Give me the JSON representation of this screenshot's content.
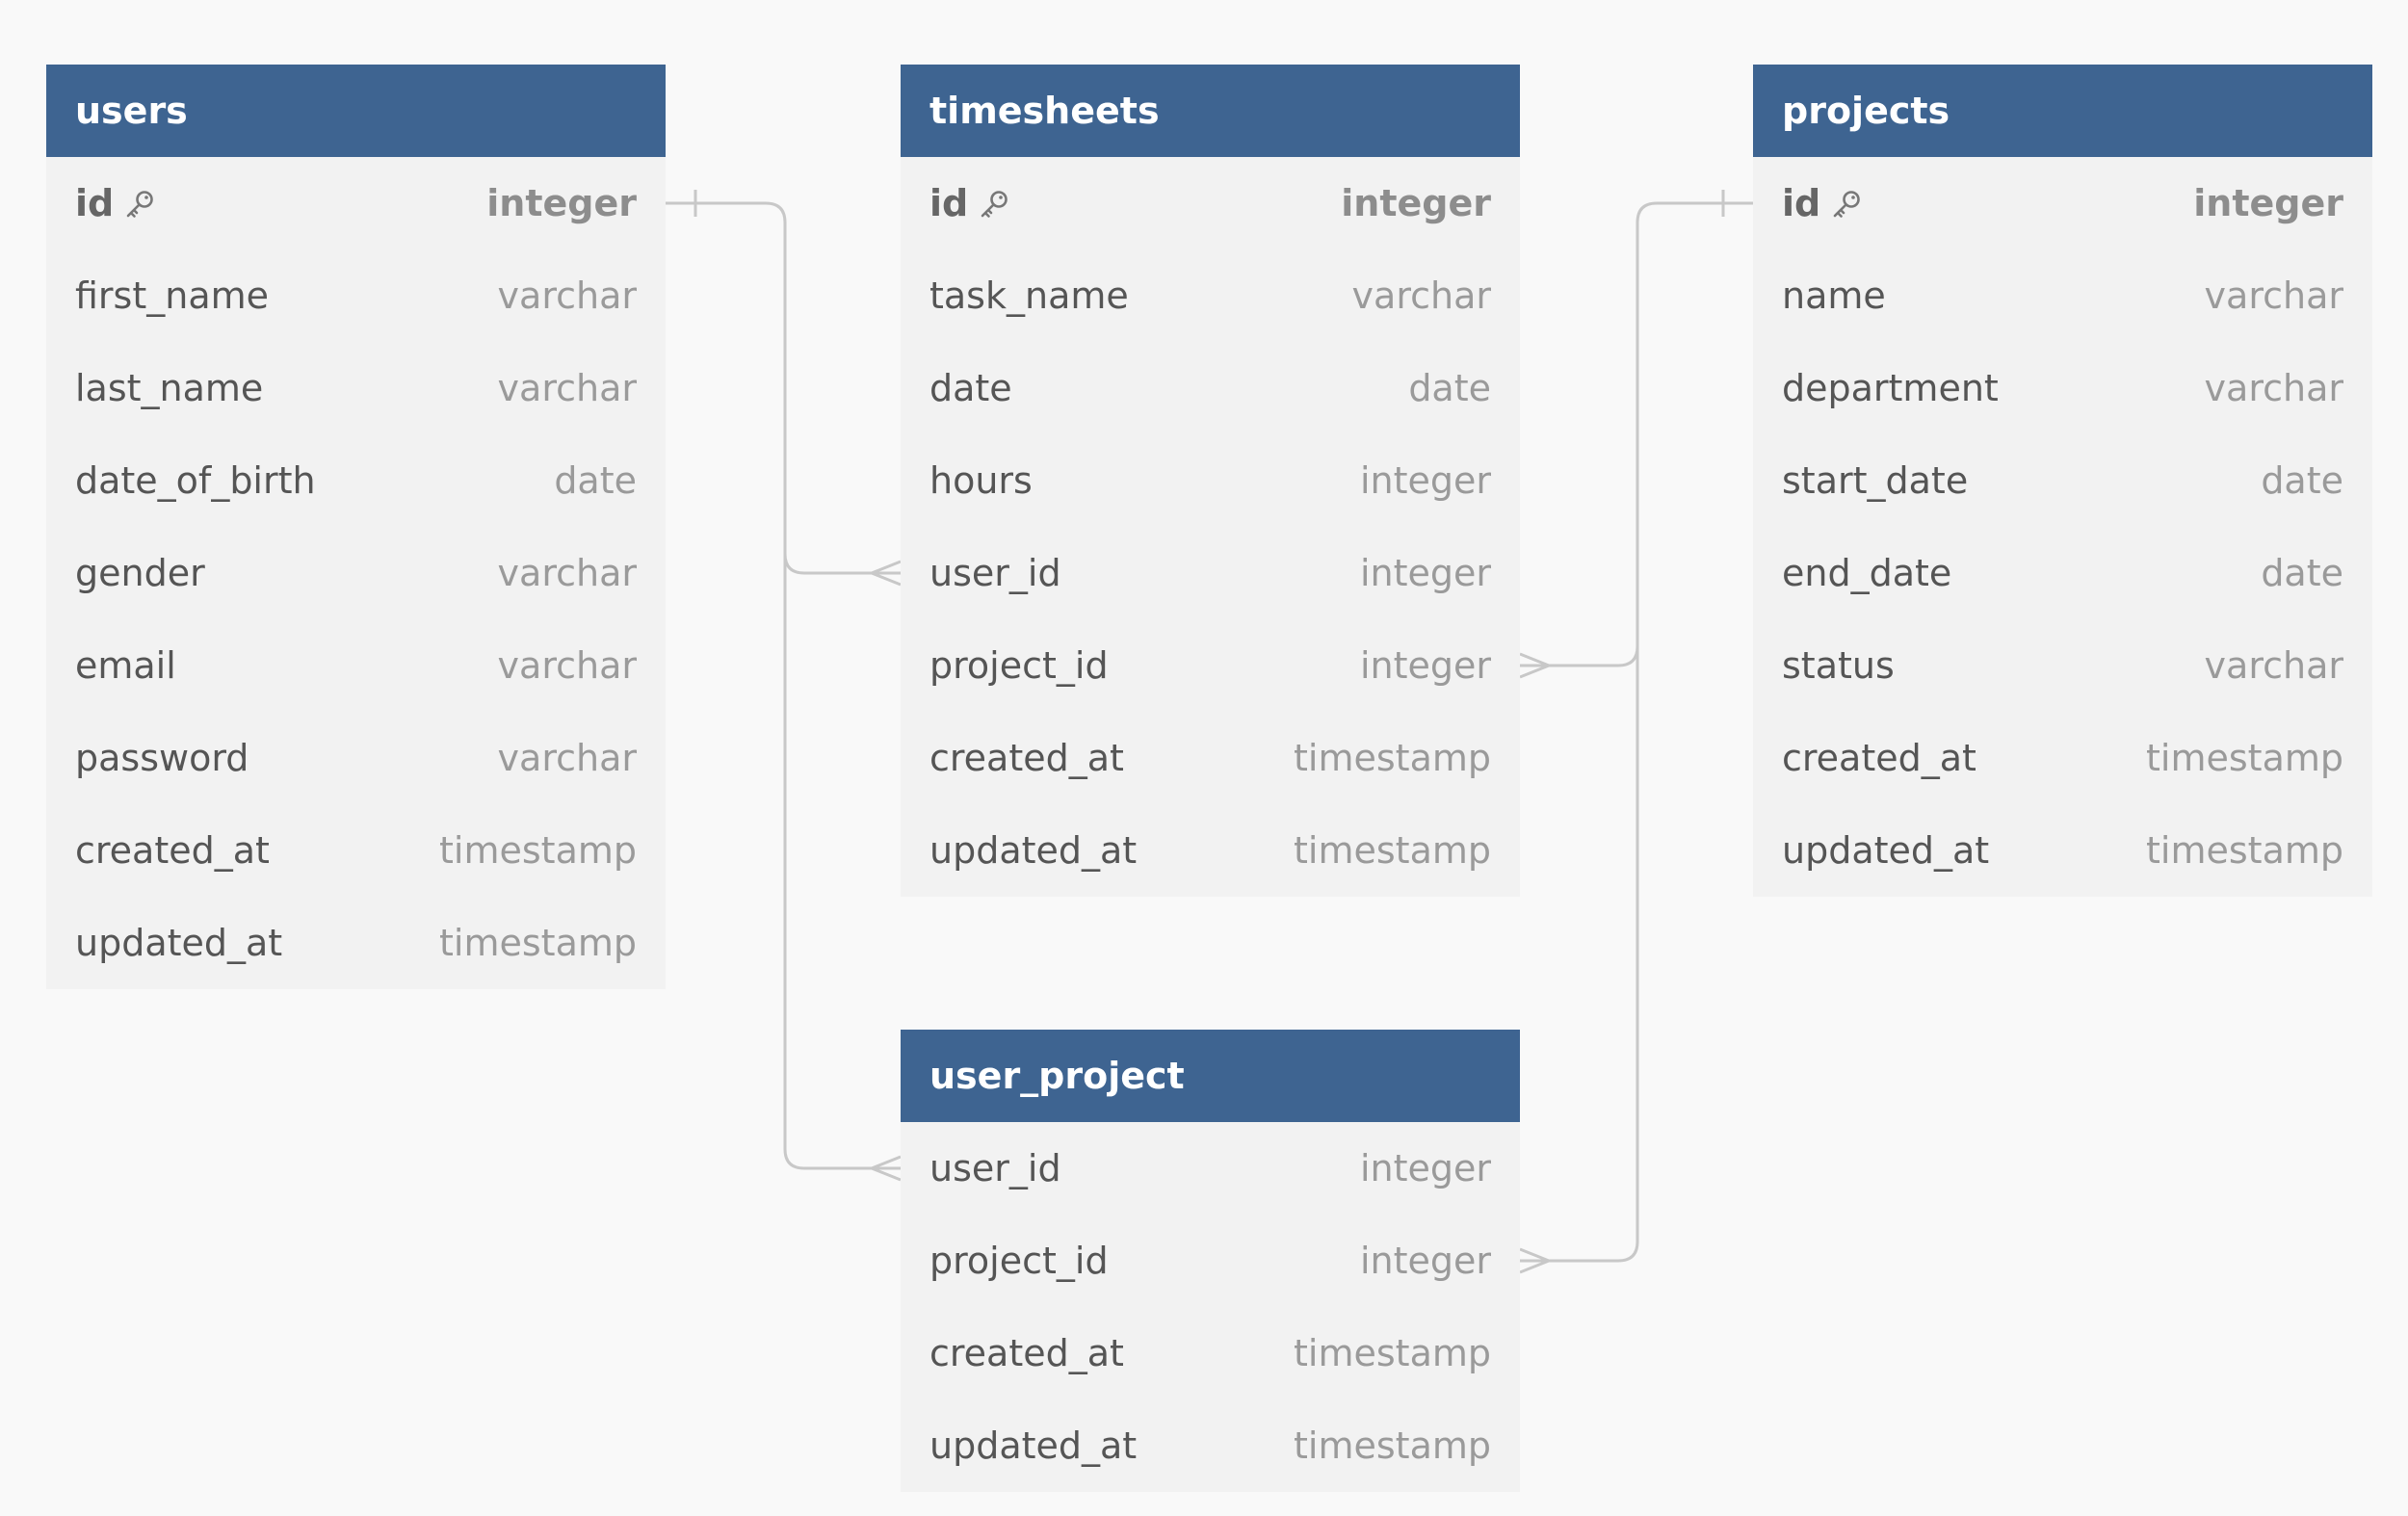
{
  "tables": {
    "users": {
      "name": "users",
      "fields": [
        {
          "name": "id",
          "type": "integer",
          "pk": true
        },
        {
          "name": "first_name",
          "type": "varchar"
        },
        {
          "name": "last_name",
          "type": "varchar"
        },
        {
          "name": "date_of_birth",
          "type": "date"
        },
        {
          "name": "gender",
          "type": "varchar"
        },
        {
          "name": "email",
          "type": "varchar"
        },
        {
          "name": "password",
          "type": "varchar"
        },
        {
          "name": "created_at",
          "type": "timestamp"
        },
        {
          "name": "updated_at",
          "type": "timestamp"
        }
      ]
    },
    "timesheets": {
      "name": "timesheets",
      "fields": [
        {
          "name": "id",
          "type": "integer",
          "pk": true
        },
        {
          "name": "task_name",
          "type": "varchar"
        },
        {
          "name": "date",
          "type": "date"
        },
        {
          "name": "hours",
          "type": "integer"
        },
        {
          "name": "user_id",
          "type": "integer"
        },
        {
          "name": "project_id",
          "type": "integer"
        },
        {
          "name": "created_at",
          "type": "timestamp"
        },
        {
          "name": "updated_at",
          "type": "timestamp"
        }
      ]
    },
    "projects": {
      "name": "projects",
      "fields": [
        {
          "name": "id",
          "type": "integer",
          "pk": true
        },
        {
          "name": "name",
          "type": "varchar"
        },
        {
          "name": "department",
          "type": "varchar"
        },
        {
          "name": "start_date",
          "type": "date"
        },
        {
          "name": "end_date",
          "type": "date"
        },
        {
          "name": "status",
          "type": "varchar"
        },
        {
          "name": "created_at",
          "type": "timestamp"
        },
        {
          "name": "updated_at",
          "type": "timestamp"
        }
      ]
    },
    "user_project": {
      "name": "user_project",
      "fields": [
        {
          "name": "user_id",
          "type": "integer"
        },
        {
          "name": "project_id",
          "type": "integer"
        },
        {
          "name": "created_at",
          "type": "timestamp"
        },
        {
          "name": "updated_at",
          "type": "timestamp"
        }
      ]
    }
  },
  "relationships": [
    {
      "from": "users.id",
      "to": "timesheets.user_id",
      "cardinality": "one-to-many"
    },
    {
      "from": "users.id",
      "to": "user_project.user_id",
      "cardinality": "one-to-many"
    },
    {
      "from": "projects.id",
      "to": "timesheets.project_id",
      "cardinality": "one-to-many"
    },
    {
      "from": "projects.id",
      "to": "user_project.project_id",
      "cardinality": "one-to-many"
    }
  ],
  "icons": {
    "primary_key": "key-icon"
  },
  "colors": {
    "header": "#3e6491",
    "table_body": "#f2f2f2",
    "background": "#f9f9f9",
    "connector": "#c8c8c8"
  }
}
